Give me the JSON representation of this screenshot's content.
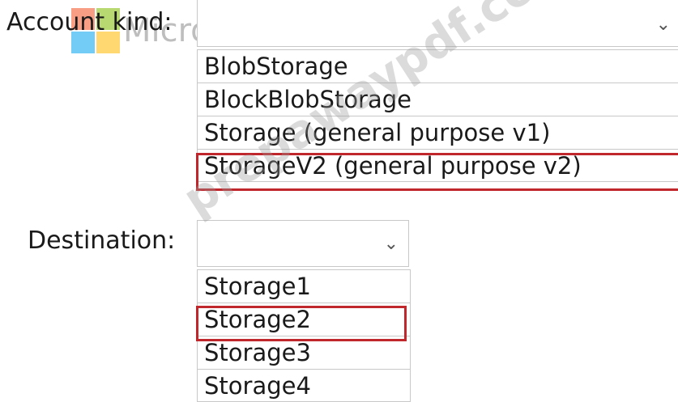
{
  "account_kind": {
    "label": "Account kind:",
    "selected_value": "",
    "options": [
      "BlobStorage",
      "BlockBlobStorage",
      "Storage (general purpose v1)",
      "StorageV2 (general purpose v2)"
    ],
    "highlighted_option": "StorageV2 (general purpose v2)"
  },
  "destination": {
    "label": "Destination:",
    "selected_value": "",
    "options": [
      "Storage1",
      "Storage2",
      "Storage3",
      "Storage4"
    ],
    "highlighted_option": "Storage2"
  },
  "icons": {
    "dropdown": "chevron-down-icon"
  },
  "watermark": {
    "brand": "Microsoft",
    "site": "prepawaypdf.com"
  },
  "colors": {
    "highlight": "#c0272d",
    "border": "#c8c8c8"
  }
}
